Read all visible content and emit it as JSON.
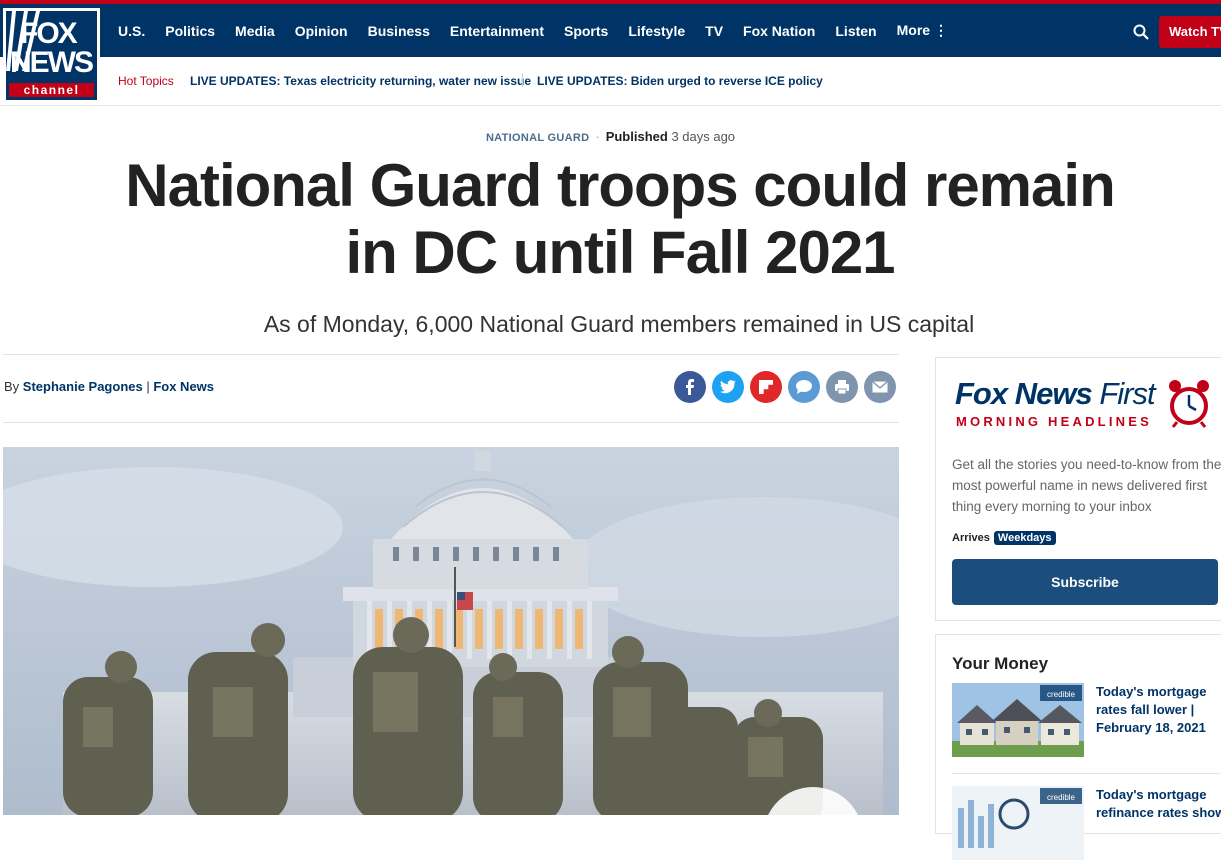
{
  "brand": {
    "logo_top": "FOX",
    "logo_bottom": "NEWS",
    "logo_channel": "channel"
  },
  "nav": {
    "items": [
      "U.S.",
      "Politics",
      "Media",
      "Opinion",
      "Business",
      "Entertainment",
      "Sports",
      "Lifestyle",
      "TV",
      "Fox Nation",
      "Listen",
      "More ⋮"
    ],
    "watch_label": "Watch TV"
  },
  "hot_topics": {
    "label": "Hot Topics",
    "items": [
      "LIVE UPDATES: Texas electricity returning, water new issue",
      "LIVE UPDATES: Biden urged to reverse ICE policy"
    ]
  },
  "article": {
    "category": "NATIONAL GUARD",
    "published_label": "Published",
    "published_ago": "3 days ago",
    "headline": "National Guard troops could remain in DC until Fall 2021",
    "subheadline": "As of Monday, 6,000 National Guard members remained in US capital",
    "byline_prefix": "By",
    "author": "Stephanie Pagones",
    "outlet": "Fox News"
  },
  "share_icons": [
    "facebook-icon",
    "twitter-icon",
    "flipboard-icon",
    "comment-icon",
    "print-icon",
    "email-icon"
  ],
  "colors": {
    "brand_navy": "#003366",
    "brand_red": "#c20017",
    "facebook": "#3b5998",
    "twitter": "#1da1f2",
    "flipboard": "#e12828",
    "comment": "#5b9bd5",
    "print": "#7e95ad",
    "email": "#7e95ad"
  },
  "newsletter": {
    "title_bold": "Fox News",
    "title_light": "First",
    "subtitle": "MORNING HEADLINES",
    "description": "Get all the stories you need-to-know from the most powerful name in news delivered first thing every morning to your inbox",
    "arrives_label": "Arrives",
    "arrives_value": "Weekdays",
    "subscribe_label": "Subscribe"
  },
  "your_money": {
    "heading": "Your Money",
    "items": [
      {
        "title": "Today's mortgage rates fall lower | February 18, 2021",
        "sponsor": "credible"
      },
      {
        "title": "Today's mortgage refinance rates show",
        "sponsor": "credible"
      }
    ]
  }
}
